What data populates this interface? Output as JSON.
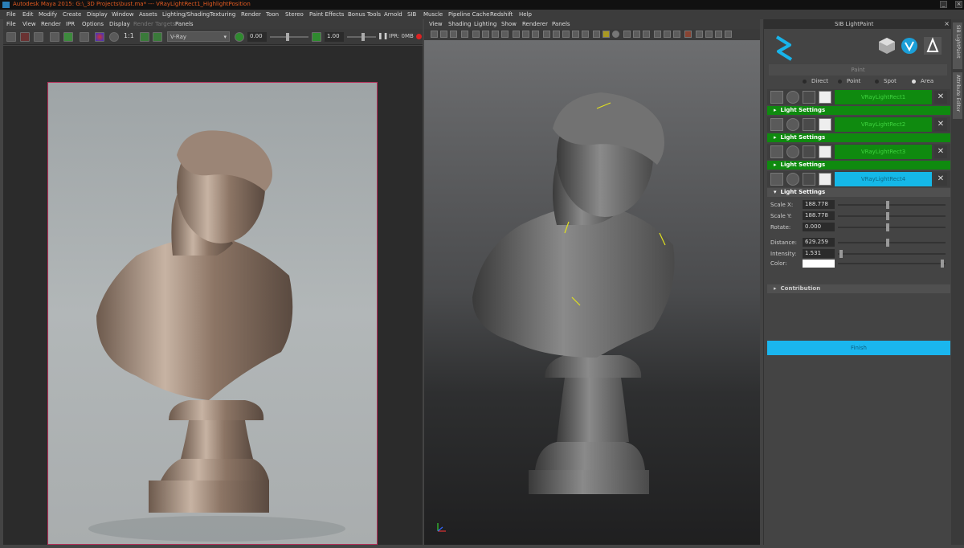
{
  "titlebar": {
    "title": "Autodesk Maya 2015: G:\\_3D Projects\\bust.ma*   ---   VRayLightRect1_HighlightPosition"
  },
  "menubar": {
    "items": [
      "File",
      "Edit",
      "Modify",
      "Create",
      "Display",
      "Window",
      "Assets",
      "Lighting/Shading",
      "Texturing",
      "Render",
      "Toon",
      "Stereo",
      "Paint Effects",
      "Bonus Tools",
      "Arnold",
      "SIB",
      "Muscle",
      "Pipeline Cache",
      "Redshift",
      "Help"
    ]
  },
  "render_view": {
    "menu": [
      "File",
      "View",
      "Render",
      "IPR",
      "Options",
      "Display",
      "Render Targets",
      "Panels"
    ],
    "renderer": "V-Ray",
    "exposure": "0.00",
    "gamma": "1.00",
    "ipr_label": "IPR: 0MB"
  },
  "viewport": {
    "menu": [
      "View",
      "Shading",
      "Lighting",
      "Show",
      "Renderer",
      "Panels"
    ]
  },
  "sib_panel": {
    "title": "SIB LightPaint",
    "mode_label": "Paint",
    "light_types": [
      "Direct",
      "Point",
      "Spot",
      "Area"
    ],
    "selected_type": "Area",
    "lights": [
      {
        "name": "VRayLightRect1",
        "selected": false
      },
      {
        "name": "VRayLightRect2",
        "selected": false
      },
      {
        "name": "VRayLightRect3",
        "selected": false
      },
      {
        "name": "VRayLightRect4",
        "selected": true
      }
    ],
    "settings_label": "Light Settings",
    "properties": {
      "scale_x_label": "Scale X:",
      "scale_x": "188.778",
      "scale_y_label": "Scale Y:",
      "scale_y": "188.778",
      "rotate_label": "Rotate:",
      "rotate": "0.000",
      "distance_label": "Distance:",
      "distance": "629.259",
      "intensity_label": "Intensity:",
      "intensity": "1.531",
      "color_label": "Color:",
      "color_value": "#ffffff"
    },
    "contribution_label": "Contribution",
    "finish_label": "Finish"
  },
  "side_tabs": [
    "SIB LightPaint",
    "Attribute Editor"
  ],
  "colors": {
    "light_green": "#0f8a0f",
    "light_selected": "#15b8e8",
    "finish": "#1ab6ee",
    "render_border": "#b5305a",
    "title_text": "#e35a20"
  }
}
